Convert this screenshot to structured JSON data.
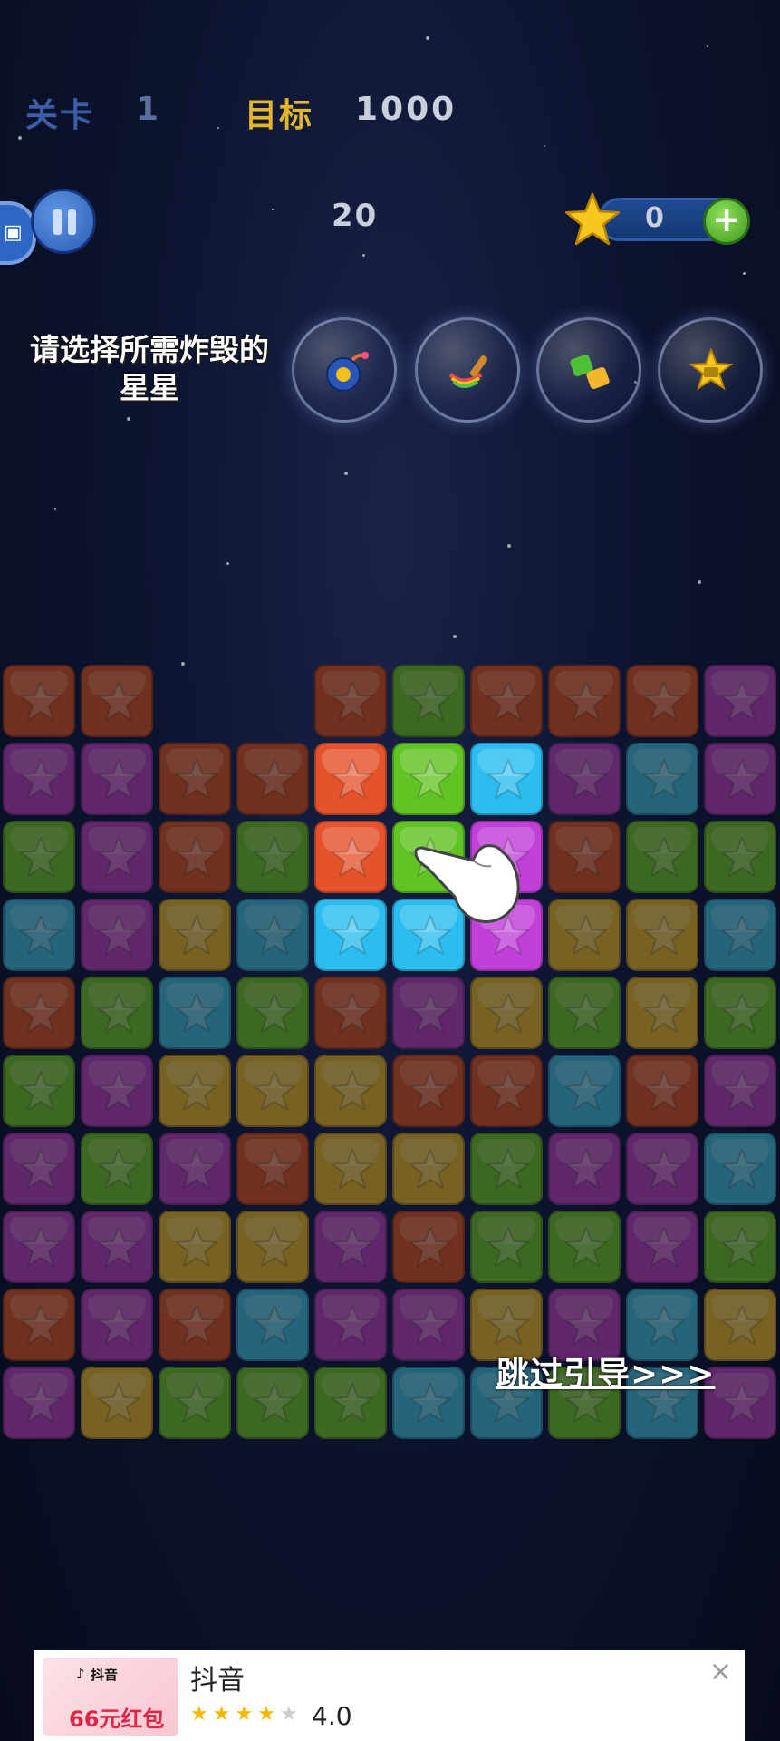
{
  "header": {
    "level_label": "关卡",
    "level_value": "1",
    "goal_label": "目标",
    "goal_value": "1000",
    "moves": "20",
    "coins": "0",
    "plus_label": "+"
  },
  "tip": {
    "line1": "请选择所需炸毁的",
    "line2": "星星"
  },
  "boosters": [
    {
      "name": "bomb",
      "icon": "bomb-icon"
    },
    {
      "name": "rainbow-brush",
      "icon": "brush-icon"
    },
    {
      "name": "swap",
      "icon": "swap-icon"
    },
    {
      "name": "video-star",
      "icon": "video-star-icon"
    }
  ],
  "colors": {
    "red": "#e5532c",
    "green": "#62c424",
    "blue": "#2bbdef",
    "purple": "#c040d8",
    "yellow": "#e3b222"
  },
  "board": {
    "rows": [
      [
        "red",
        "red",
        null,
        null,
        "red",
        "green",
        "red",
        "red",
        "red",
        "purple"
      ],
      [
        "purple",
        "purple",
        "red",
        "red",
        "red",
        "green",
        "blue",
        "purple",
        "blue",
        "purple"
      ],
      [
        "green",
        "purple",
        "red",
        "green",
        "red",
        "green",
        "purple",
        "red",
        "green",
        "green"
      ],
      [
        "blue",
        "purple",
        "yellow",
        "blue",
        "blue",
        "blue",
        "purple",
        "yellow",
        "yellow",
        "blue"
      ],
      [
        "red",
        "green",
        "blue",
        "green",
        "red",
        "purple",
        "yellow",
        "green",
        "yellow",
        "green"
      ],
      [
        "green",
        "purple",
        "yellow",
        "yellow",
        "yellow",
        "red",
        "red",
        "blue",
        "red",
        "purple"
      ],
      [
        "purple",
        "green",
        "purple",
        "red",
        "yellow",
        "yellow",
        "green",
        "purple",
        "purple",
        "blue"
      ],
      [
        "purple",
        "purple",
        "yellow",
        "yellow",
        "purple",
        "red",
        "green",
        "green",
        "purple",
        "green"
      ],
      [
        "red",
        "purple",
        "red",
        "blue",
        "purple",
        "purple",
        "yellow",
        "purple",
        "blue",
        "yellow"
      ],
      [
        "purple",
        "yellow",
        "green",
        "green",
        "green",
        "blue",
        "blue",
        "green",
        "blue",
        "purple"
      ]
    ],
    "highlighted": [
      [
        1,
        4
      ],
      [
        1,
        5
      ],
      [
        1,
        6
      ],
      [
        2,
        4
      ],
      [
        2,
        5
      ],
      [
        2,
        6
      ],
      [
        3,
        4
      ],
      [
        3,
        5
      ],
      [
        3,
        6
      ]
    ]
  },
  "skip_label": "跳过引导>>>",
  "ad": {
    "thumb_brand": "抖音",
    "thumb_promo": "66元红包",
    "title": "抖音",
    "rating": "4.0",
    "stars_on": 4,
    "close": "×"
  }
}
